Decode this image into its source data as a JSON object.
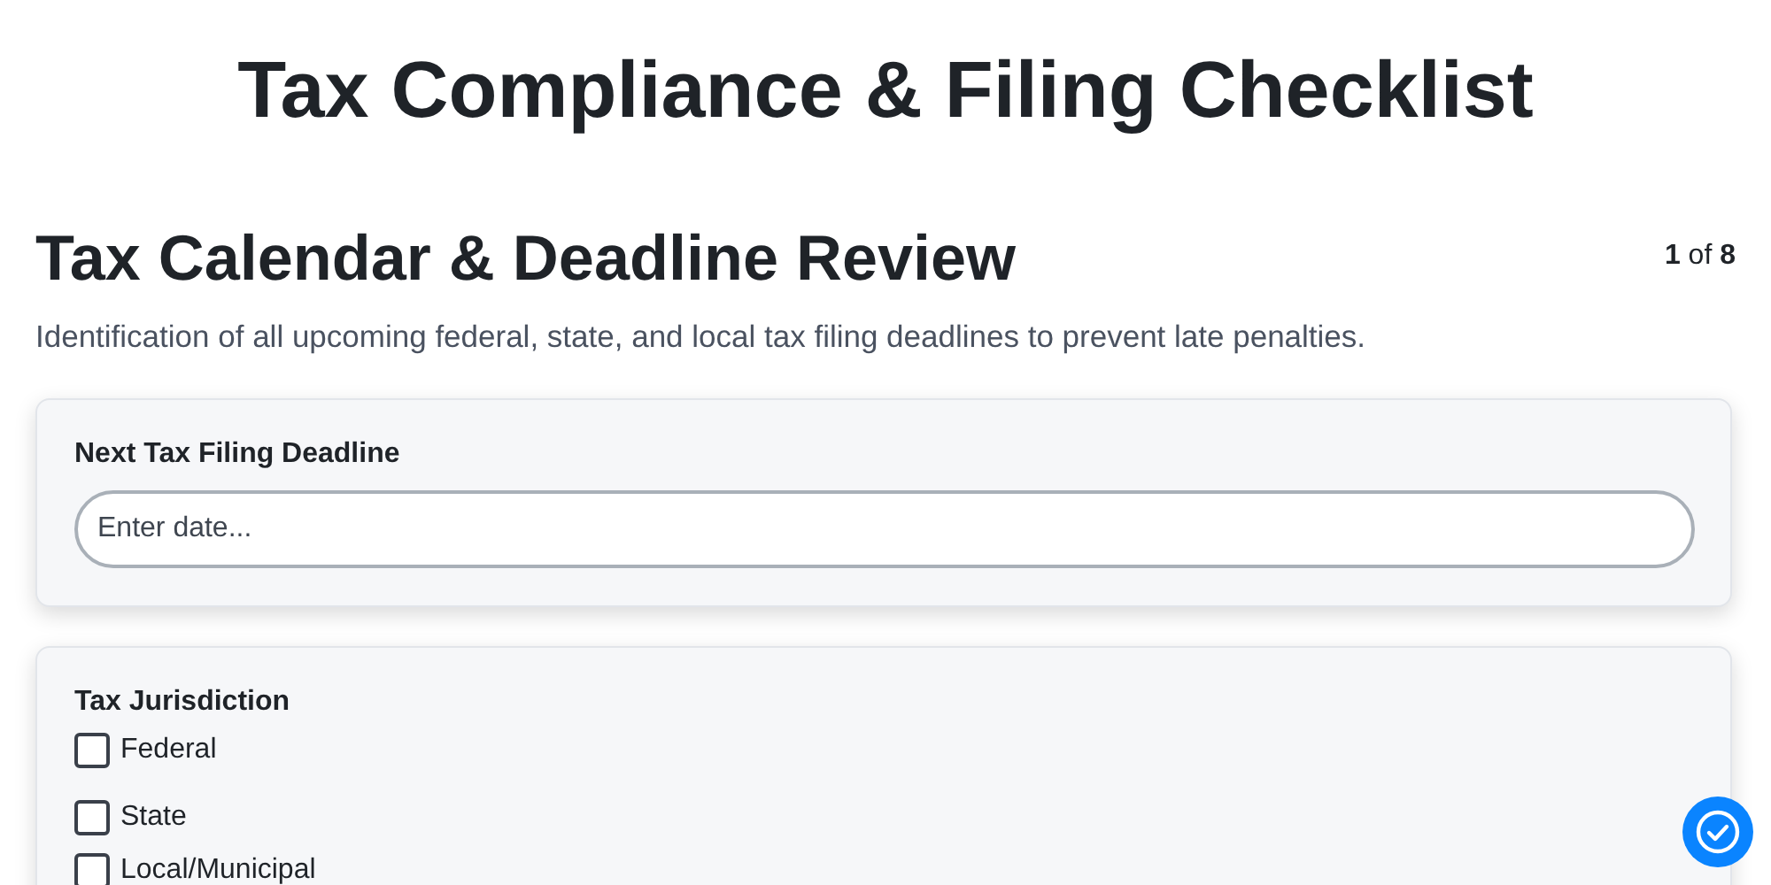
{
  "title": "Tax Compliance & Filing Checklist",
  "section": {
    "heading": "Tax Calendar & Deadline Review",
    "progress": "**1** of **8**",
    "description": "Identification of all upcoming federal, state, and local tax filing deadlines to prevent late penalties."
  },
  "questions": [
    {
      "kind": "text",
      "label": "Next Tax Filing Deadline",
      "placeholder": "Enter date..."
    },
    {
      "kind": "checklist",
      "label": "Tax Jurisdiction",
      "options": [
        {
          "label": "Federal",
          "checked": false
        },
        {
          "label": "State",
          "checked": false
        },
        {
          "label": "Local/Municipal",
          "checked": false
        }
      ]
    }
  ]
}
